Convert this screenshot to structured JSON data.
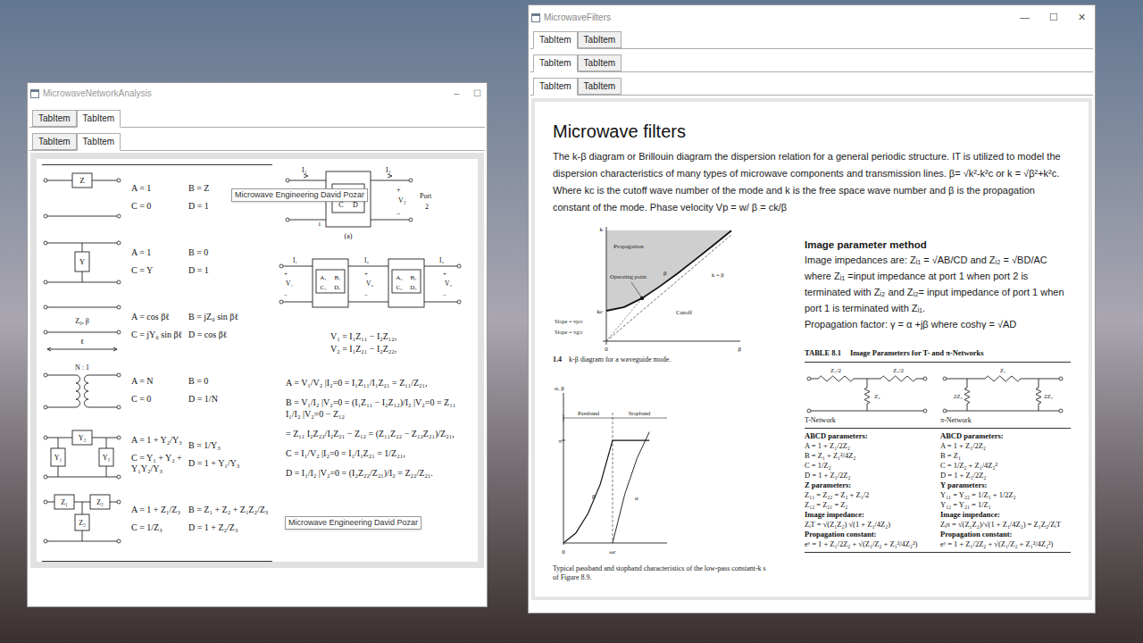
{
  "network_window": {
    "title": "MicrowaveNetworkAnalysis",
    "controls": [
      "–",
      "☐"
    ],
    "tab_rows": [
      [
        {
          "label": "TabItem",
          "selected": false
        },
        {
          "label": "TabItem",
          "selected": true
        }
      ],
      [
        {
          "label": "TabItem",
          "selected": false
        },
        {
          "label": "TabItem",
          "selected": true
        }
      ]
    ],
    "circuits": [
      {
        "kind": "series",
        "labels": [
          "Z"
        ],
        "A": "A = 1",
        "B": "B = Z",
        "C": "C = 0",
        "D": "D = 1"
      },
      {
        "kind": "shunt",
        "labels": [
          "Y"
        ],
        "A": "A = 1",
        "B": "B = 0",
        "C": "C = Y",
        "D": "D = 1"
      },
      {
        "kind": "line",
        "labels": [
          "Z₀, β",
          "ℓ"
        ],
        "A": "A = cos βℓ",
        "B": "B = jZ₀ sin βℓ",
        "C": "C = jY₀ sin βℓ",
        "D": "D = cos βℓ"
      },
      {
        "kind": "transformer",
        "labels": [
          "N : 1"
        ],
        "A": "A = N",
        "B": "B = 0",
        "C": "C = 0",
        "D": "D = 1/N"
      },
      {
        "kind": "pi",
        "labels": [
          "Y₃",
          "Y₁",
          "Y₂"
        ],
        "A": "A = 1 + Y₂/Y₃",
        "B": "B = 1/Y₃",
        "C": "C = Y₁ + Y₂ + Y₁Y₂/Y₃",
        "D": "D = 1 + Y₁/Y₃"
      },
      {
        "kind": "tee",
        "labels": [
          "Z₁",
          "Z₂",
          "Z₃"
        ],
        "A": "A = 1 + Z₁/Z₃",
        "B": "B = Z₁ + Z₂ + Z₁Z₂/Z₃",
        "C": "C = 1/Z₃",
        "D": "D = 1 + Z₂/Z₃"
      }
    ],
    "two_port": {
      "currents": [
        "I₁",
        "I₂"
      ],
      "voltage": "V₂",
      "polarity": [
        "+",
        "−"
      ],
      "matrix": [
        "A",
        "B",
        "C",
        "D"
      ],
      "port_label": "Port",
      "port_number": "2",
      "port1_number": "1",
      "caption": "(a)"
    },
    "cascade": {
      "currents": [
        "I₁",
        "I₂",
        "I₃"
      ],
      "voltages": [
        "V₁",
        "V₂",
        "V₃"
      ],
      "polarity": [
        "+",
        "−"
      ],
      "blocks": [
        [
          "A₁",
          "B₁",
          "C₁",
          "D₁"
        ],
        [
          "A₂",
          "B₂",
          "C₂",
          "D₂"
        ]
      ]
    },
    "z_equations": [
      "V₁ = I₁Z₁₁ − I₂Z₁₂,",
      "V₂ = I₁Z₂₁ − I₂Z₂₂,"
    ],
    "abcd_equations": [
      "A = V₁/V₂ |I₂=0 = I₁Z₁₁/I₁Z₂₁ = Z₁₁/Z₂₁,",
      "B = V₁/I₂ |V₂=0 = (I₁Z₁₁ − I₂Z₁₂)/I₂ |V₂=0 = Z₁₁ I₁/I₂ |V₂=0 − Z₁₂",
      "= Z₁₁ I₂Z₂₂/I₂Z₂₁ − Z₁₂ = (Z₁₁Z₂₂ − Z₁₂Z₂₁)/Z₂₁,",
      "C = I₁/V₂ |I₂=0 = I₁/I₁Z₂₁ = 1/Z₂₁,",
      "D = I₁/I₂ |V₂=0 = (I₂Z₂₂/Z₂₁)/I₂ = Z₂₂/Z₂₁."
    ],
    "tooltips": [
      "Microwave Engineering David Pozar",
      "Microwave Engineering David Pozar"
    ]
  },
  "filters_window": {
    "title": "MicrowaveFilters",
    "controls": [
      "—",
      "☐",
      "✕"
    ],
    "tab_rows": [
      [
        {
          "label": "TabItem",
          "selected": true
        },
        {
          "label": "TabItem",
          "selected": false
        }
      ],
      [
        {
          "label": "TabItem",
          "selected": true
        },
        {
          "label": "TabItem",
          "selected": false
        }
      ],
      [
        {
          "label": "TabItem",
          "selected": true
        },
        {
          "label": "TabItem",
          "selected": false
        }
      ]
    ],
    "heading": "Microwave filters",
    "intro": "The k-β diagram or Brillouin diagram the dispersion relation for a general periodic structure. IT is utilized to model the dispersion characteristics of many types of microwave components and transmission lines. β= √k²-k²c or k = √β²+k²c. Where kc is the cutoff wave number of the mode and k is the free space wave number and β is the propagation constant of the mode. Phase velocity Vp = w/ β = ck/β",
    "kb_chart": {
      "axis_y": "k",
      "axis_x": "β",
      "origin": "0",
      "beta": [
        0,
        1,
        2,
        3,
        4,
        5,
        6,
        7
      ],
      "k": [
        2,
        2.24,
        2.83,
        3.61,
        4.47,
        5.39,
        6.32,
        7.28
      ],
      "labels": {
        "propagation": "Propagation",
        "operating_point": "Operating point",
        "curve": "β",
        "asymptote": "k = β",
        "cutoff": "Cutoff",
        "kc": "kc",
        "slope_p": "Slope = vp/c",
        "slope_g": "Slope = vg/c"
      },
      "caption_number": "1.4",
      "caption": "k-β diagram for a waveguide mode."
    },
    "band_chart": {
      "axis_y": "α, β",
      "origin": "0",
      "pi": "π",
      "cutoff": "ωc",
      "passband": "Passband",
      "stopband": "Stopband",
      "omega": [
        0,
        0.25,
        0.5,
        0.75,
        1,
        1.25,
        1.5,
        1.75
      ],
      "beta": [
        0,
        0.3,
        0.9,
        1.8,
        3.14,
        3.14,
        3.14,
        3.14
      ],
      "alpha": [
        0,
        0,
        0,
        0,
        0,
        1.5,
        2.6,
        3.4
      ],
      "beta_label": "β",
      "alpha_label": "α",
      "caption": [
        "Typical passband and stopband characteristics of the low-pass constant-k s",
        "of Figure 8.9."
      ]
    },
    "image_section": {
      "heading": "Image parameter method",
      "lines": [
        "Image impedances are: Zᵢ₁ = √AB/CD and Zᵢ₂ = √BD/AC where Zᵢ₁ =input impedance at port 1 when port 2 is terminated with Zᵢ₂ and Zᵢ₂= input impedance of port 1 when port 1 is terminated with Zᵢ₁.",
        "Propagation factor: γ = α +jβ where coshγ = √AD"
      ]
    },
    "table": {
      "number": "TABLE 8.1",
      "title": "Image Parameters for T- and π-Networks",
      "networks": [
        {
          "name": "T-Network",
          "kind": "tee",
          "labels": [
            "Z₁/2",
            "Z₁/2",
            "Z₂"
          ],
          "entries": [
            {
              "kind": "heading",
              "text": "ABCD parameters:"
            },
            {
              "kind": "formula",
              "text": "A = 1 + Z₁/2Z₂"
            },
            {
              "kind": "formula",
              "text": "B = Z₁ + Z₁²/4Z₂"
            },
            {
              "kind": "formula",
              "text": "C = 1/Z₂"
            },
            {
              "kind": "formula",
              "text": "D = 1 + Z₁/2Z₂"
            },
            {
              "kind": "heading",
              "text": "Z parameters:"
            },
            {
              "kind": "formula",
              "text": "Z₁₁ = Z₂₂ = Z₂ + Z₁/2"
            },
            {
              "kind": "formula",
              "text": "Z₁₂ = Z₂₁ = Z₂"
            },
            {
              "kind": "heading",
              "text": "Image impedance:"
            },
            {
              "kind": "formula",
              "text": "ZᵢT = √(Z₁Z₂) √(1 + Z₁/4Z₂)"
            },
            {
              "kind": "heading",
              "text": "Propagation constant:"
            },
            {
              "kind": "formula",
              "text": "eᵞ = 1 + Z₁/2Z₂ + √(Z₁/Z₂ + Z₁²/4Z₂²)"
            }
          ]
        },
        {
          "name": "π-Network",
          "kind": "pi",
          "labels": [
            "Z₁",
            "2Z₂",
            "2Z₂"
          ],
          "entries": [
            {
              "kind": "heading",
              "text": "ABCD parameters:"
            },
            {
              "kind": "formula",
              "text": "A = 1 + Z₁/2Z₂"
            },
            {
              "kind": "formula",
              "text": "B = Z₁"
            },
            {
              "kind": "formula",
              "text": "C = 1/Z₂ + Z₁/4Z₂²"
            },
            {
              "kind": "formula",
              "text": "D = 1 + Z₁/2Z₂"
            },
            {
              "kind": "heading",
              "text": "Y parameters:"
            },
            {
              "kind": "formula",
              "text": "Y₁₁ = Y₂₂ = 1/Z₁ + 1/2Z₂"
            },
            {
              "kind": "formula",
              "text": "Y₁₂ = Y₂₁ = 1/Z₁"
            },
            {
              "kind": "heading",
              "text": "Image impedance:"
            },
            {
              "kind": "formula",
              "text": "Zᵢπ = √(Z₁Z₂)/√(1 + Z₁/4Z₂) = Z₁Z₂/ZᵢT"
            },
            {
              "kind": "heading",
              "text": "Propagation constant:"
            },
            {
              "kind": "formula",
              "text": "eᵞ = 1 + Z₁/2Z₂ + √(Z₁/Z₂ + Z₁²/4Z₂²)"
            }
          ]
        }
      ]
    }
  }
}
